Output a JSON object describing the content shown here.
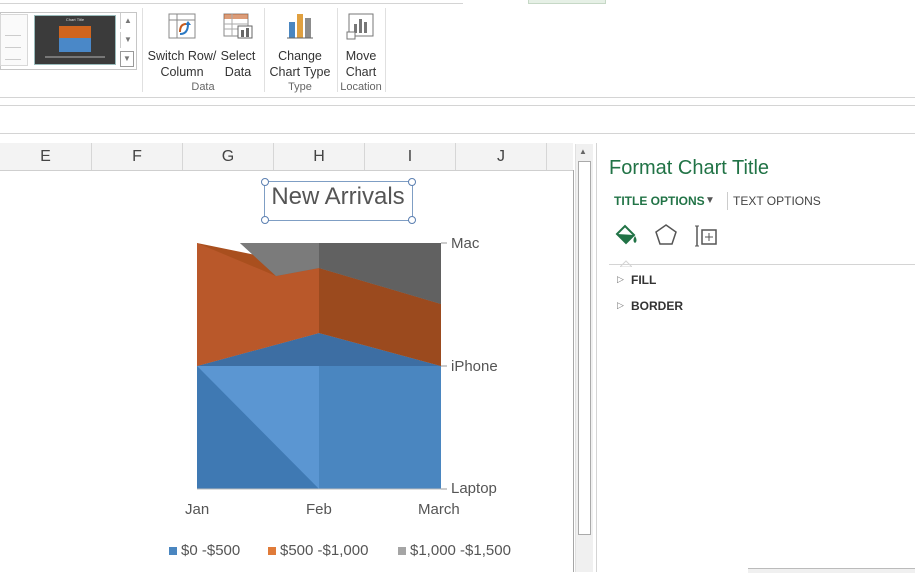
{
  "ribbon": {
    "buttons": {
      "switch_row_col_1": "Switch Row/",
      "switch_row_col_2": "Column",
      "select_data_1": "Select",
      "select_data_2": "Data",
      "change_type_1": "Change",
      "change_type_2": "Chart Type",
      "move_chart_1": "Move",
      "move_chart_2": "Chart"
    },
    "groups": {
      "data": "Data",
      "type": "Type",
      "location": "Location"
    },
    "thumbnail_title": "Chart Title"
  },
  "columns": [
    "E",
    "F",
    "G",
    "H",
    "I",
    "J"
  ],
  "chart": {
    "title": "New Arrivals"
  },
  "chart_data": {
    "type": "area",
    "title": "New Arrivals",
    "categories": [
      "Jan",
      "Feb",
      "March"
    ],
    "depth_labels": [
      "Laptop",
      "iPhone",
      "Mac"
    ],
    "series": [
      {
        "name": "$0 -$500",
        "color": "#4a86c0"
      },
      {
        "name": "$500 -$1,000",
        "color": "#c55a1e"
      },
      {
        "name": "$1,000 -$1,500",
        "color": "#8c8c8c"
      }
    ],
    "grid": false,
    "legend_position": "bottom"
  },
  "pane": {
    "title": "Format Chart Title",
    "tab_title_options": "TITLE OPTIONS",
    "tab_text_options": "TEXT OPTIONS",
    "sections": [
      "FILL",
      "BORDER"
    ]
  }
}
